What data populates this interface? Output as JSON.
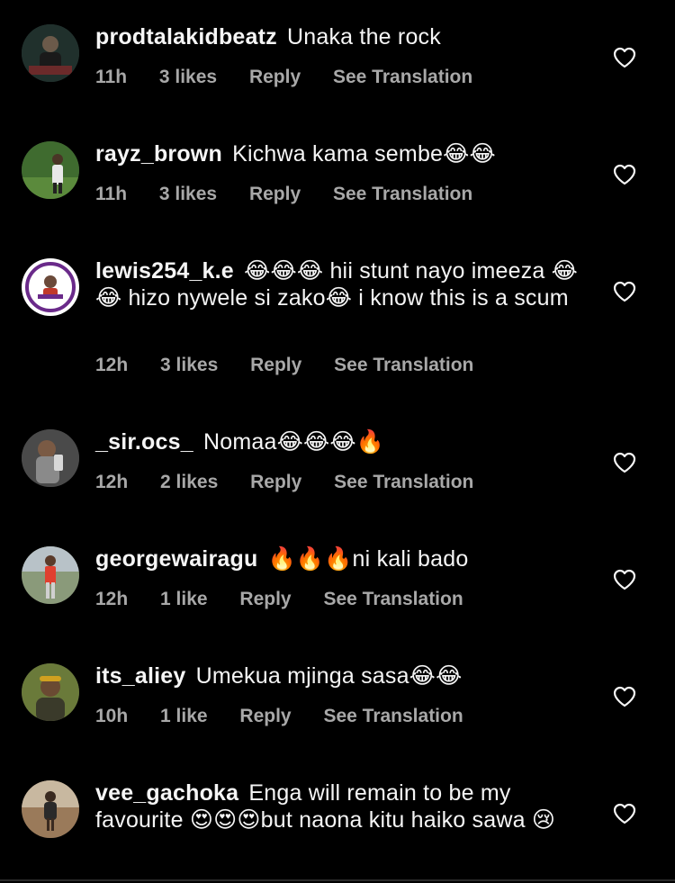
{
  "comments": [
    {
      "username": "prodtalakidbeatz",
      "text": "Unaka the rock",
      "time": "11h",
      "likes": "3 likes",
      "reply": "Reply",
      "translate": "See Translation",
      "avatar_icon": "avatar-photo-icon"
    },
    {
      "username": "rayz_brown",
      "text": "Kichwa  kama sembe😂😂",
      "time": "11h",
      "likes": "3 likes",
      "reply": "Reply",
      "translate": "See Translation",
      "avatar_icon": "avatar-photo-icon"
    },
    {
      "username": "lewis254_k.e",
      "text": "😂😂😂 hii stunt nayo imeeza 😂😂 hizo nywele si zako😂 i know this is a scum",
      "time": "12h",
      "likes": "3 likes",
      "reply": "Reply",
      "translate": "See Translation",
      "avatar_icon": "avatar-logo-icon"
    },
    {
      "username": "_sir.ocs_",
      "text": "Nomaa😂😂😂🔥",
      "time": "12h",
      "likes": "2 likes",
      "reply": "Reply",
      "translate": "See Translation",
      "avatar_icon": "avatar-photo-icon"
    },
    {
      "username": "georgewairagu",
      "text": "🔥🔥🔥ni kali bado",
      "time": "12h",
      "likes": "1 like",
      "reply": "Reply",
      "translate": "See Translation",
      "avatar_icon": "avatar-photo-icon"
    },
    {
      "username": "its_aliey",
      "text": "Umekua mjinga sasa😂😂",
      "time": "10h",
      "likes": "1 like",
      "reply": "Reply",
      "translate": "See Translation",
      "avatar_icon": "avatar-photo-icon"
    },
    {
      "username": "vee_gachoka",
      "text": "Enga will remain to be my favourite 😍😍😍but naona kitu haiko sawa 😢",
      "time": "",
      "likes": "",
      "reply": "",
      "translate": "",
      "avatar_icon": "avatar-photo-icon"
    }
  ],
  "colors": {
    "background": "#000000",
    "text": "#f5f5f5",
    "secondary_text": "#a8a8a8",
    "heart_outline": "#f5f5f5"
  }
}
